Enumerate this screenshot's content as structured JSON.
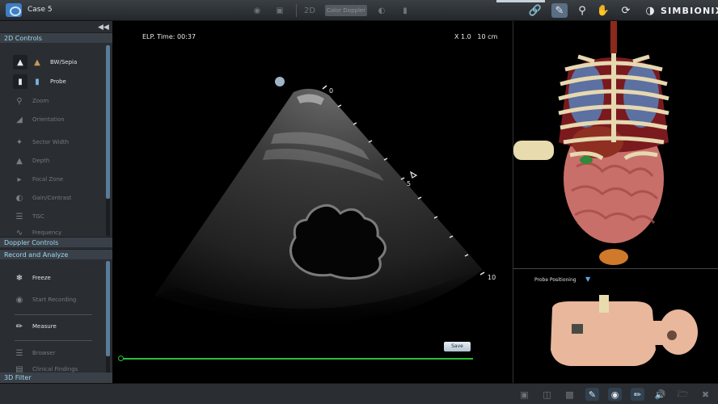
{
  "topbar": {
    "case_title": "Case 5",
    "mode_2d": "2D",
    "color_doppler": "Color Doppler",
    "brand": "SIMBIONIX",
    "left_icons": [
      "camera-icon",
      "camera-icon",
      "layers-icon",
      "contrast-icon",
      "clipboard-icon"
    ],
    "right_icons": [
      "link-icon",
      "probe-icon",
      "zoom-icon",
      "hand-icon",
      "rotate-icon",
      "half-circle-icon"
    ]
  },
  "left_panel": {
    "collapse_icon": "double-chevron-left-icon",
    "controls_2d_header": "2D Controls",
    "controls": [
      {
        "label": "BW/Sepia",
        "icon": "bw-sepia-icon",
        "active": true
      },
      {
        "label": "Probe",
        "icon": "probe-icon",
        "active": true
      },
      {
        "label": "Zoom",
        "icon": "zoom-icon",
        "active": false
      },
      {
        "label": "Orientation",
        "icon": "orientation-icon",
        "active": false
      },
      {
        "label": "Sector Width",
        "icon": "sector-width-icon",
        "active": false
      },
      {
        "label": "Depth",
        "icon": "depth-icon",
        "active": false
      },
      {
        "label": "Focal Zone",
        "icon": "focal-zone-icon",
        "active": false
      },
      {
        "label": "Gain/Contrast",
        "icon": "gain-contrast-icon",
        "active": false
      },
      {
        "label": "TGC",
        "icon": "tgc-icon",
        "active": false
      },
      {
        "label": "Frequency",
        "icon": "frequency-icon",
        "active": false
      }
    ],
    "doppler_header": "Doppler Controls",
    "record_header": "Record and Analyze",
    "record_items": [
      {
        "label": "Freeze",
        "icon": "snowflake-icon",
        "active": true
      },
      {
        "label": "Start Recording",
        "icon": "record-icon",
        "active": false
      },
      {
        "label": "Measure",
        "icon": "ruler-icon",
        "active": true
      },
      {
        "label": "Browser",
        "icon": "browser-icon",
        "active": false
      },
      {
        "label": "Clinical Findings",
        "icon": "clinical-findings-icon",
        "active": false
      }
    ],
    "filter_header": "3D Filter"
  },
  "ultrasound": {
    "elapsed": "ELP. Time: 00:37",
    "zoom": "X 1.0",
    "depth": "10 cm",
    "depth_marks": [
      "0",
      "5",
      "10"
    ],
    "save_label": "Save"
  },
  "probe_positioning": {
    "label": "Probe Positioning",
    "arrow_icon": "triangle-down-icon"
  },
  "bottom_bar_icons": [
    "screen-icon",
    "split-icon",
    "screen-alt-icon",
    "probe-icon",
    "probe-3d-icon",
    "probe-hand-icon",
    "speaker-icon",
    "folder-icon",
    "close-icon"
  ],
  "colors": {
    "accent": "#9fd8f0",
    "timeline": "#2cbf34",
    "panel": "#2a2e33"
  }
}
